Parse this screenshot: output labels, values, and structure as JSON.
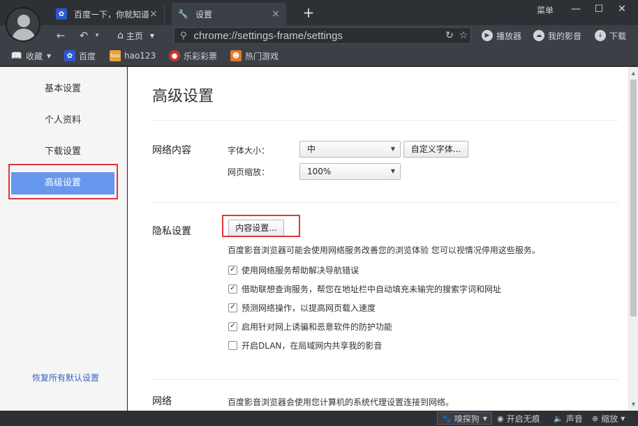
{
  "tabs": [
    {
      "title": "百度一下，你就知道",
      "icon": "baidu-paw-icon",
      "active": false
    },
    {
      "title": "设置",
      "icon": "wrench-icon",
      "active": true
    }
  ],
  "window": {
    "menu_label": "菜单",
    "new_tab": "+",
    "minimize": "—",
    "maximize": "☐",
    "close": "✕"
  },
  "nav": {
    "back": "←",
    "undo": "↶",
    "dropdown": "▾",
    "home_label": "主页",
    "address_url": "chrome://settings-frame/settings",
    "player_label": "播放器",
    "my_video_label": "我的影音",
    "download_label": "下载"
  },
  "bookmarks": [
    {
      "label": "收藏",
      "icon": "book-icon"
    },
    {
      "label": "百度",
      "icon": "baidu-paw-icon"
    },
    {
      "label": "hao123",
      "icon": "hao123-icon"
    },
    {
      "label": "乐彩彩票",
      "icon": "lottery-icon"
    },
    {
      "label": "热门游戏",
      "icon": "game-icon"
    }
  ],
  "sidebar": {
    "items": [
      {
        "label": "基本设置",
        "active": false
      },
      {
        "label": "个人资料",
        "active": false
      },
      {
        "label": "下载设置",
        "active": false
      },
      {
        "label": "高级设置",
        "active": true
      }
    ],
    "restore_label": "恢复所有默认设置"
  },
  "main": {
    "title": "高级设置",
    "web_content": {
      "title": "网络内容",
      "font_size_label": "字体大小：",
      "font_size_value": "中",
      "custom_font_button": "自定义字体...",
      "zoom_label": "网页缩放：",
      "zoom_value": "100%"
    },
    "privacy": {
      "title": "隐私设置",
      "content_settings_button": "内容设置...",
      "description": "百度影音浏览器可能会使用网络服务改善您的浏览体验 您可以视情况停用这些服务。",
      "options": [
        {
          "label": "使用网络服务帮助解决导航错误",
          "checked": true
        },
        {
          "label": "借助联想查询服务，帮您在地址栏中自动填充未输完的搜索字词和网址",
          "checked": true
        },
        {
          "label": "预测网络操作，以提高网页载入速度",
          "checked": true
        },
        {
          "label": "启用针对网上诱骗和恶意软件的防护功能",
          "checked": true
        },
        {
          "label": "开启DLAN，在局域网内共享我的影音",
          "checked": false
        }
      ]
    },
    "network": {
      "title": "网络",
      "description": "百度影音浏览器会使用您计算机的系统代理设置连接到网络。"
    }
  },
  "status": {
    "explore_label": "嗅探狗",
    "no_image_label": "开启无痕",
    "sound_label": "声音",
    "zoom_label": "缩放"
  },
  "colors": {
    "highlight_red": "#e0353b",
    "sidebar_active": "#6699ee",
    "chrome_dark": "#3c4046"
  }
}
